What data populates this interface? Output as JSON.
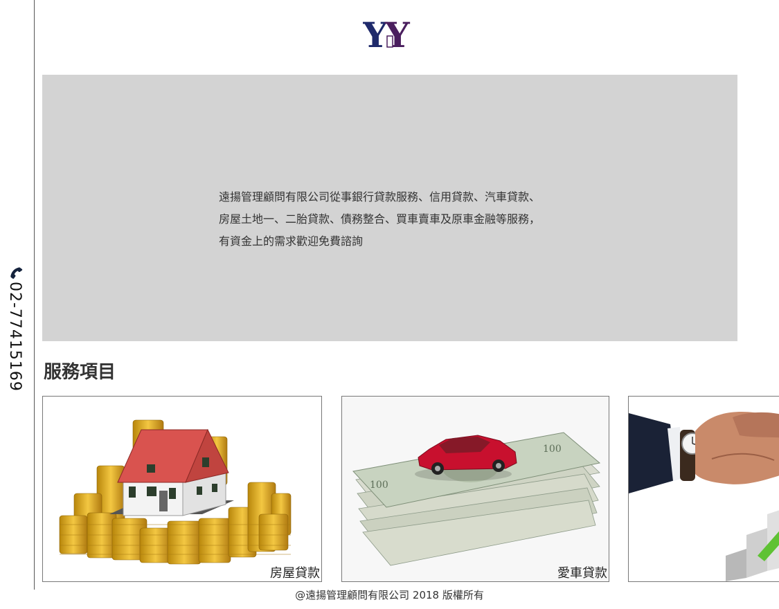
{
  "sidebar": {
    "phone_icon": "phone-icon",
    "phone_number": "02-77415169"
  },
  "header": {
    "logo_text": "YY"
  },
  "intro": {
    "lines": [
      "遠揚管理顧問有限公司從事銀行貸款服務、信用貸款、汽車貸款、",
      "房屋土地一、二胎貸款、債務整合、買車賣車及原車金融等服務，",
      "有資金上的需求歡迎免費諮詢"
    ]
  },
  "services": {
    "title": "服務項目",
    "items": [
      {
        "label": "房屋貸款",
        "image": "house-on-coins"
      },
      {
        "label": "愛車貸款",
        "image": "toy-car-on-cash"
      },
      {
        "label": "",
        "image": "handshake"
      }
    ]
  },
  "footer": {
    "copyright": "@遠揚管理顧問有限公司 2018  版權所有"
  },
  "colors": {
    "logo_navy": "#1f2a6b",
    "logo_purple": "#4a1e5e",
    "panel_grey": "#d3d3d3"
  }
}
